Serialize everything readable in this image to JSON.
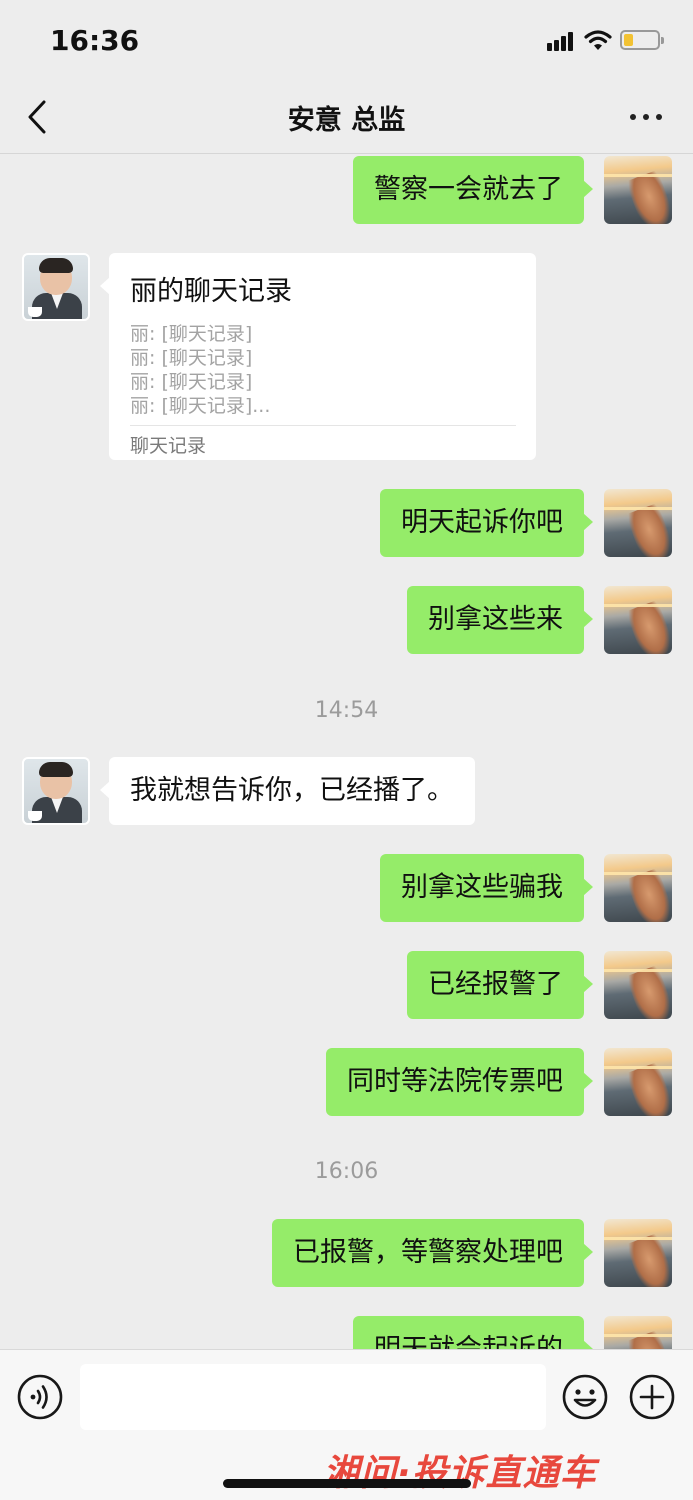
{
  "status_bar": {
    "time": "16:36"
  },
  "header": {
    "title": "安意 总监"
  },
  "chat": {
    "messages": [
      {
        "text": "警察一会就去了"
      },
      {
        "text": "明天起诉你吧"
      },
      {
        "text": "别拿这些来"
      },
      {
        "text": "我就想告诉你，已经播了。"
      },
      {
        "text": "别拿这些骗我"
      },
      {
        "text": "已经报警了"
      },
      {
        "text": "同时等法院传票吧"
      },
      {
        "text": "已报警，等警察处理吧"
      },
      {
        "text": "明天就会起诉的"
      }
    ],
    "chat_record": {
      "title": "丽的聊天记录",
      "lines": [
        "丽: [聊天记录]",
        "丽: [聊天记录]",
        "丽: [聊天记录]",
        "丽: [聊天记录]..."
      ],
      "footer": "聊天记录"
    },
    "time_dividers": [
      "14:54",
      "16:06"
    ]
  },
  "input_bar": {
    "value": ""
  },
  "watermark": {
    "text": "湘问·投诉直通车"
  }
}
